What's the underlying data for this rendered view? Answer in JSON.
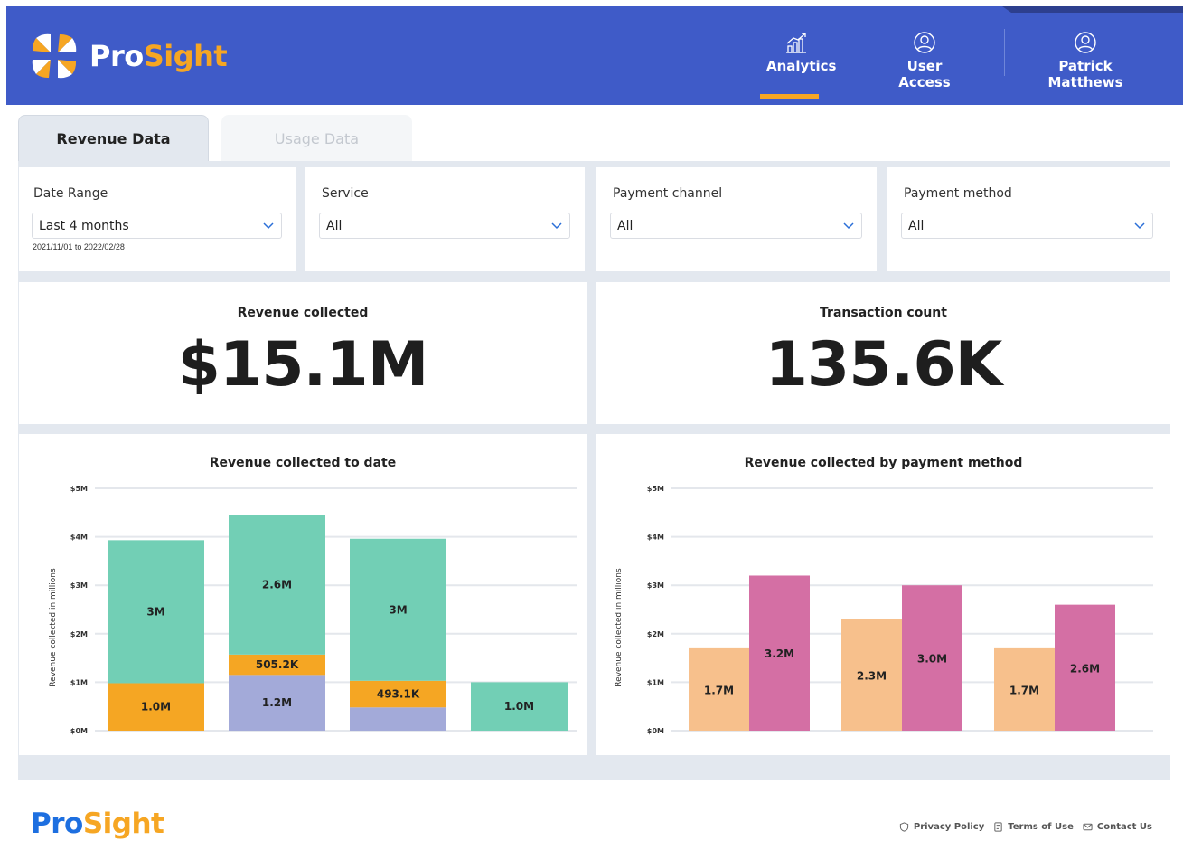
{
  "brand": {
    "pro": "Pro",
    "sight": "Sight",
    "accent": "#f6a623",
    "header_bg": "#3f5bc8"
  },
  "nav": {
    "analytics": {
      "label": "Analytics",
      "icon": "analytics-chart-icon"
    },
    "user_access": {
      "label": "User Access",
      "icon": "user-circle-icon"
    },
    "user": {
      "label": "Patrick Matthews",
      "icon": "user-circle-icon"
    }
  },
  "tabs": [
    {
      "label": "Revenue Data",
      "active": true
    },
    {
      "label": "Usage Data",
      "active": false
    }
  ],
  "filters": {
    "date_range": {
      "label": "Date Range",
      "value": "Last 4 months",
      "note": "2021/11/01 to 2022/02/28"
    },
    "service": {
      "label": "Service",
      "value": "All"
    },
    "payment_channel": {
      "label": "Payment channel",
      "value": "All"
    },
    "payment_method": {
      "label": "Payment method",
      "value": "All"
    }
  },
  "kpis": {
    "revenue": {
      "title": "Revenue collected",
      "value": "$15.1M"
    },
    "transactions": {
      "title": "Transaction count",
      "value": "135.6K"
    }
  },
  "chart_data": [
    {
      "type": "bar",
      "stacked": true,
      "title": "Revenue collected to date",
      "xlabel": "",
      "ylabel": "Revenue collected in millions",
      "ylim": [
        0,
        5
      ],
      "yticks": [
        "$0M",
        "$1M",
        "$2M",
        "$3M",
        "$4M",
        "$5M"
      ],
      "grid": true,
      "categories": [
        "",
        "",
        "",
        ""
      ],
      "series": [
        {
          "color": "#a3aad9",
          "values": [
            0,
            1.15,
            0.48,
            0
          ],
          "labels": [
            "",
            "1.2M",
            "",
            ""
          ]
        },
        {
          "color": "#f5a623",
          "values": [
            0.98,
            0.42,
            0.55,
            0
          ],
          "labels": [
            "1.0M",
            "505.2K",
            "493.1K",
            ""
          ]
        },
        {
          "color": "#72cfb5",
          "values": [
            2.95,
            2.88,
            2.93,
            1.0
          ],
          "labels": [
            "3M",
            "2.6M",
            "3M",
            "1.0M"
          ]
        }
      ]
    },
    {
      "type": "bar",
      "title": "Revenue collected by payment method",
      "xlabel": "",
      "ylabel": "Revenue collected in millions",
      "ylim": [
        0,
        5
      ],
      "yticks": [
        "$0M",
        "$1M",
        "$2M",
        "$3M",
        "$4M",
        "$5M"
      ],
      "grid": true,
      "categories": [
        "",
        "",
        ""
      ],
      "series": [
        {
          "color": "#f7c08c",
          "values": [
            1.7,
            2.3,
            1.7
          ],
          "labels": [
            "1.7M",
            "2.3M",
            "1.7M"
          ]
        },
        {
          "color": "#d46fa4",
          "values": [
            3.2,
            3.0,
            2.6
          ],
          "labels": [
            "3.2M",
            "3.0M",
            "2.6M"
          ]
        }
      ]
    }
  ],
  "footer": {
    "links": [
      {
        "label": "Privacy Policy",
        "icon": "shield-icon"
      },
      {
        "label": "Terms of Use",
        "icon": "document-icon"
      },
      {
        "label": "Contact Us",
        "icon": "mail-icon"
      }
    ]
  }
}
